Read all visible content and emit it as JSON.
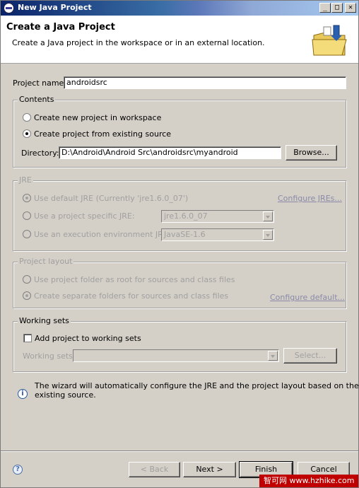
{
  "window": {
    "title": "New Java Project",
    "controls": {
      "minimize": "_",
      "maximize": "□",
      "close": "✕"
    }
  },
  "banner": {
    "heading": "Create a Java Project",
    "description": "Create a Java project in the workspace or in an external location."
  },
  "project_name": {
    "label": "Project name:",
    "value": "androidsrc"
  },
  "contents": {
    "title": "Contents",
    "option_new": "Create new project in workspace",
    "option_existing": "Create project from existing source",
    "selected": "existing",
    "directory_label": "Directory:",
    "directory_value": "D:\\Android\\Android Src\\androidsrc\\myandroid",
    "browse_label": "Browse..."
  },
  "jre": {
    "title": "JRE",
    "option_default": "Use default JRE (Currently 'jre1.6.0_07')",
    "option_specific": "Use a project specific JRE:",
    "option_env": "Use an execution environment JRE:",
    "specific_value": "jre1.6.0_07",
    "env_value": "JavaSE-1.6",
    "configure_link": "Configure JREs..."
  },
  "project_layout": {
    "title": "Project layout",
    "option_root": "Use project folder as root for sources and class files",
    "option_separate": "Create separate folders for sources and class files",
    "configure_link": "Configure default..."
  },
  "working_sets": {
    "title": "Working sets",
    "checkbox_label": "Add project to working sets",
    "sets_label": "Working sets:",
    "sets_value": "",
    "select_label": "Select..."
  },
  "info_message": {
    "line1": "The wizard will automatically configure the JRE and the project layout based on the",
    "line2": "existing source."
  },
  "buttons": {
    "back": "< Back",
    "next": "Next >",
    "finish": "Finish",
    "cancel": "Cancel"
  },
  "watermark": "智可网 www.hzhike.com",
  "icons": {
    "app": "eclipse-icon",
    "wizard": "new-java-project-wizard-icon",
    "info": "info-icon",
    "help": "help-icon"
  }
}
